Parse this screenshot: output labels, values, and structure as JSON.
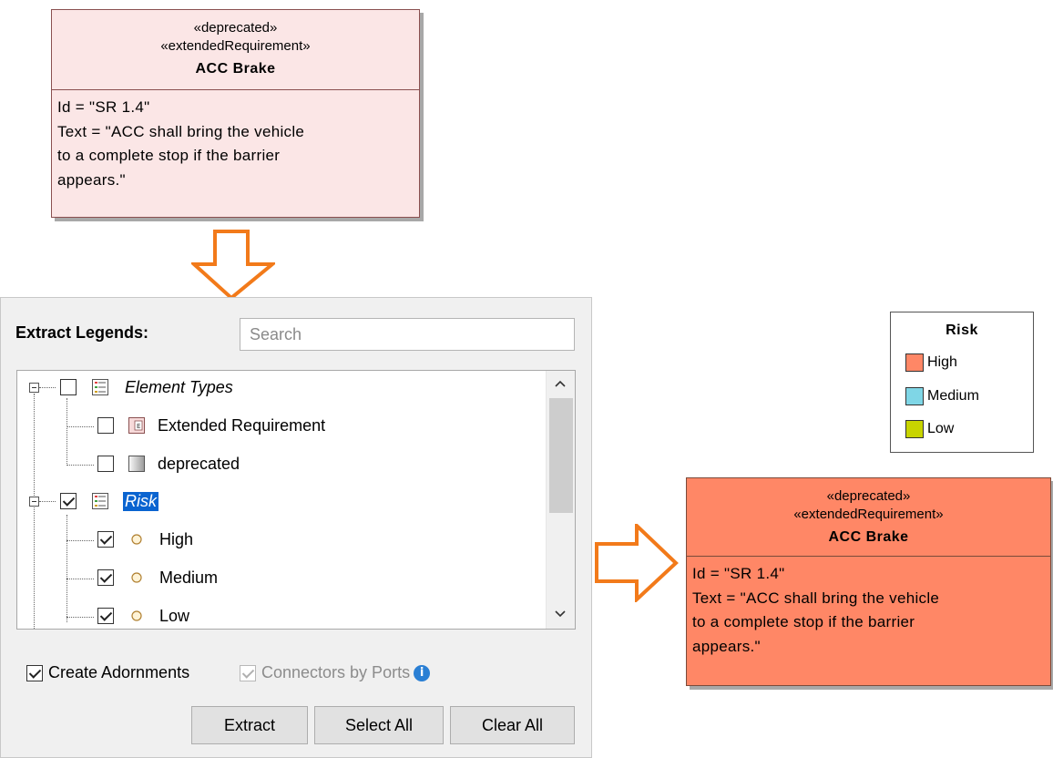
{
  "top_requirement": {
    "stereotype1": "«deprecated»",
    "stereotype2": "«extendedRequirement»",
    "name": "ACC Brake",
    "line1": "Id = \"SR 1.4\"",
    "line2": "Text = \"ACC shall bring the vehicle",
    "line3": "to a complete stop if the barrier",
    "line4": "appears.\"",
    "fill": "#fbe6e6"
  },
  "bottom_requirement": {
    "stereotype1": "«deprecated»",
    "stereotype2": "«extendedRequirement»",
    "name": "ACC Brake",
    "line1": "Id = \"SR 1.4\"",
    "line2": "Text = \"ACC shall bring the vehicle",
    "line3": "to a complete stop if the barrier",
    "line4": "appears.\"",
    "fill": "#ff8766"
  },
  "arrow_color": "#f27a1a",
  "panel": {
    "title": "Extract Legends:",
    "search_placeholder": "Search",
    "tree": [
      {
        "label": "Element Types",
        "checked": false,
        "icon": "legend-list-icon"
      },
      {
        "label": "Extended Requirement",
        "checked": false,
        "icon": "extended-requirement-icon"
      },
      {
        "label": "deprecated",
        "checked": false,
        "icon": "gradient-swatch-icon"
      },
      {
        "label": "Risk",
        "checked": true,
        "icon": "legend-list-icon",
        "selected": true
      },
      {
        "label": "High",
        "checked": true,
        "icon": "circle-icon"
      },
      {
        "label": "Medium",
        "checked": true,
        "icon": "circle-icon"
      },
      {
        "label": "Low",
        "checked": true,
        "icon": "circle-icon"
      }
    ],
    "create_adornments_label": "Create Adornments",
    "create_adornments_checked": true,
    "connectors_by_ports_label": "Connectors by Ports",
    "connectors_by_ports_checked": true,
    "buttons": {
      "extract": "Extract",
      "select_all": "Select All",
      "clear_all": "Clear All"
    }
  },
  "legend": {
    "title": "Risk",
    "items": [
      {
        "label": "High",
        "color": "#ff8766"
      },
      {
        "label": "Medium",
        "color": "#7fd6e6"
      },
      {
        "label": "Low",
        "color": "#c8d400"
      }
    ]
  }
}
